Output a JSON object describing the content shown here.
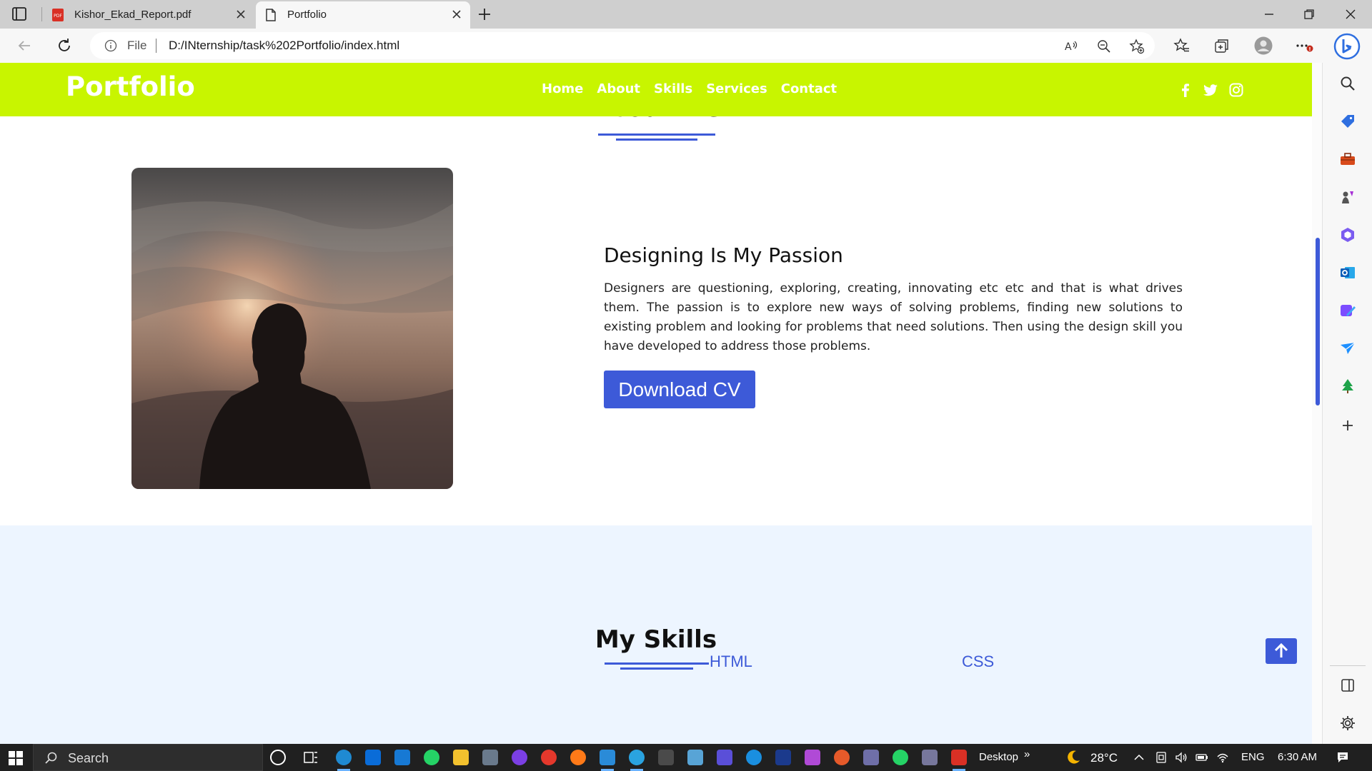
{
  "browser": {
    "tabs": [
      {
        "title": "Kishor_Ekad_Report.pdf",
        "active": false
      },
      {
        "title": "Portfolio",
        "active": true
      }
    ],
    "address": {
      "scheme_label": "File",
      "url": "D:/INternship/task%202Portfolio/index.html"
    }
  },
  "site": {
    "brand": "Portfolio",
    "nav": [
      "Home",
      "About",
      "Skills",
      "Services",
      "Contact"
    ],
    "social_icons": [
      "facebook-icon",
      "twitter-icon",
      "instagram-icon"
    ]
  },
  "about": {
    "heading": "About Me",
    "title": "Designing Is My Passion",
    "paragraph": "Designers are questioning, exploring, creating, innovating etc etc and that is what drives them. The passion is to explore new ways of solving problems, finding new solutions to existing problem and looking for problems that need solutions. Then using the design skill you have developed to address those problems.",
    "cta": "Download CV"
  },
  "skills": {
    "heading": "My Skills",
    "items": [
      "HTML",
      "CSS"
    ]
  },
  "taskbar": {
    "search_label": "Search",
    "desktop_label": "Desktop",
    "temperature": "28°C",
    "language": "ENG",
    "time": "6:30 AM"
  },
  "colors": {
    "accent": "#3d5ad8",
    "nav_bg": "#c8f500",
    "skills_bg": "#edf5ff"
  }
}
